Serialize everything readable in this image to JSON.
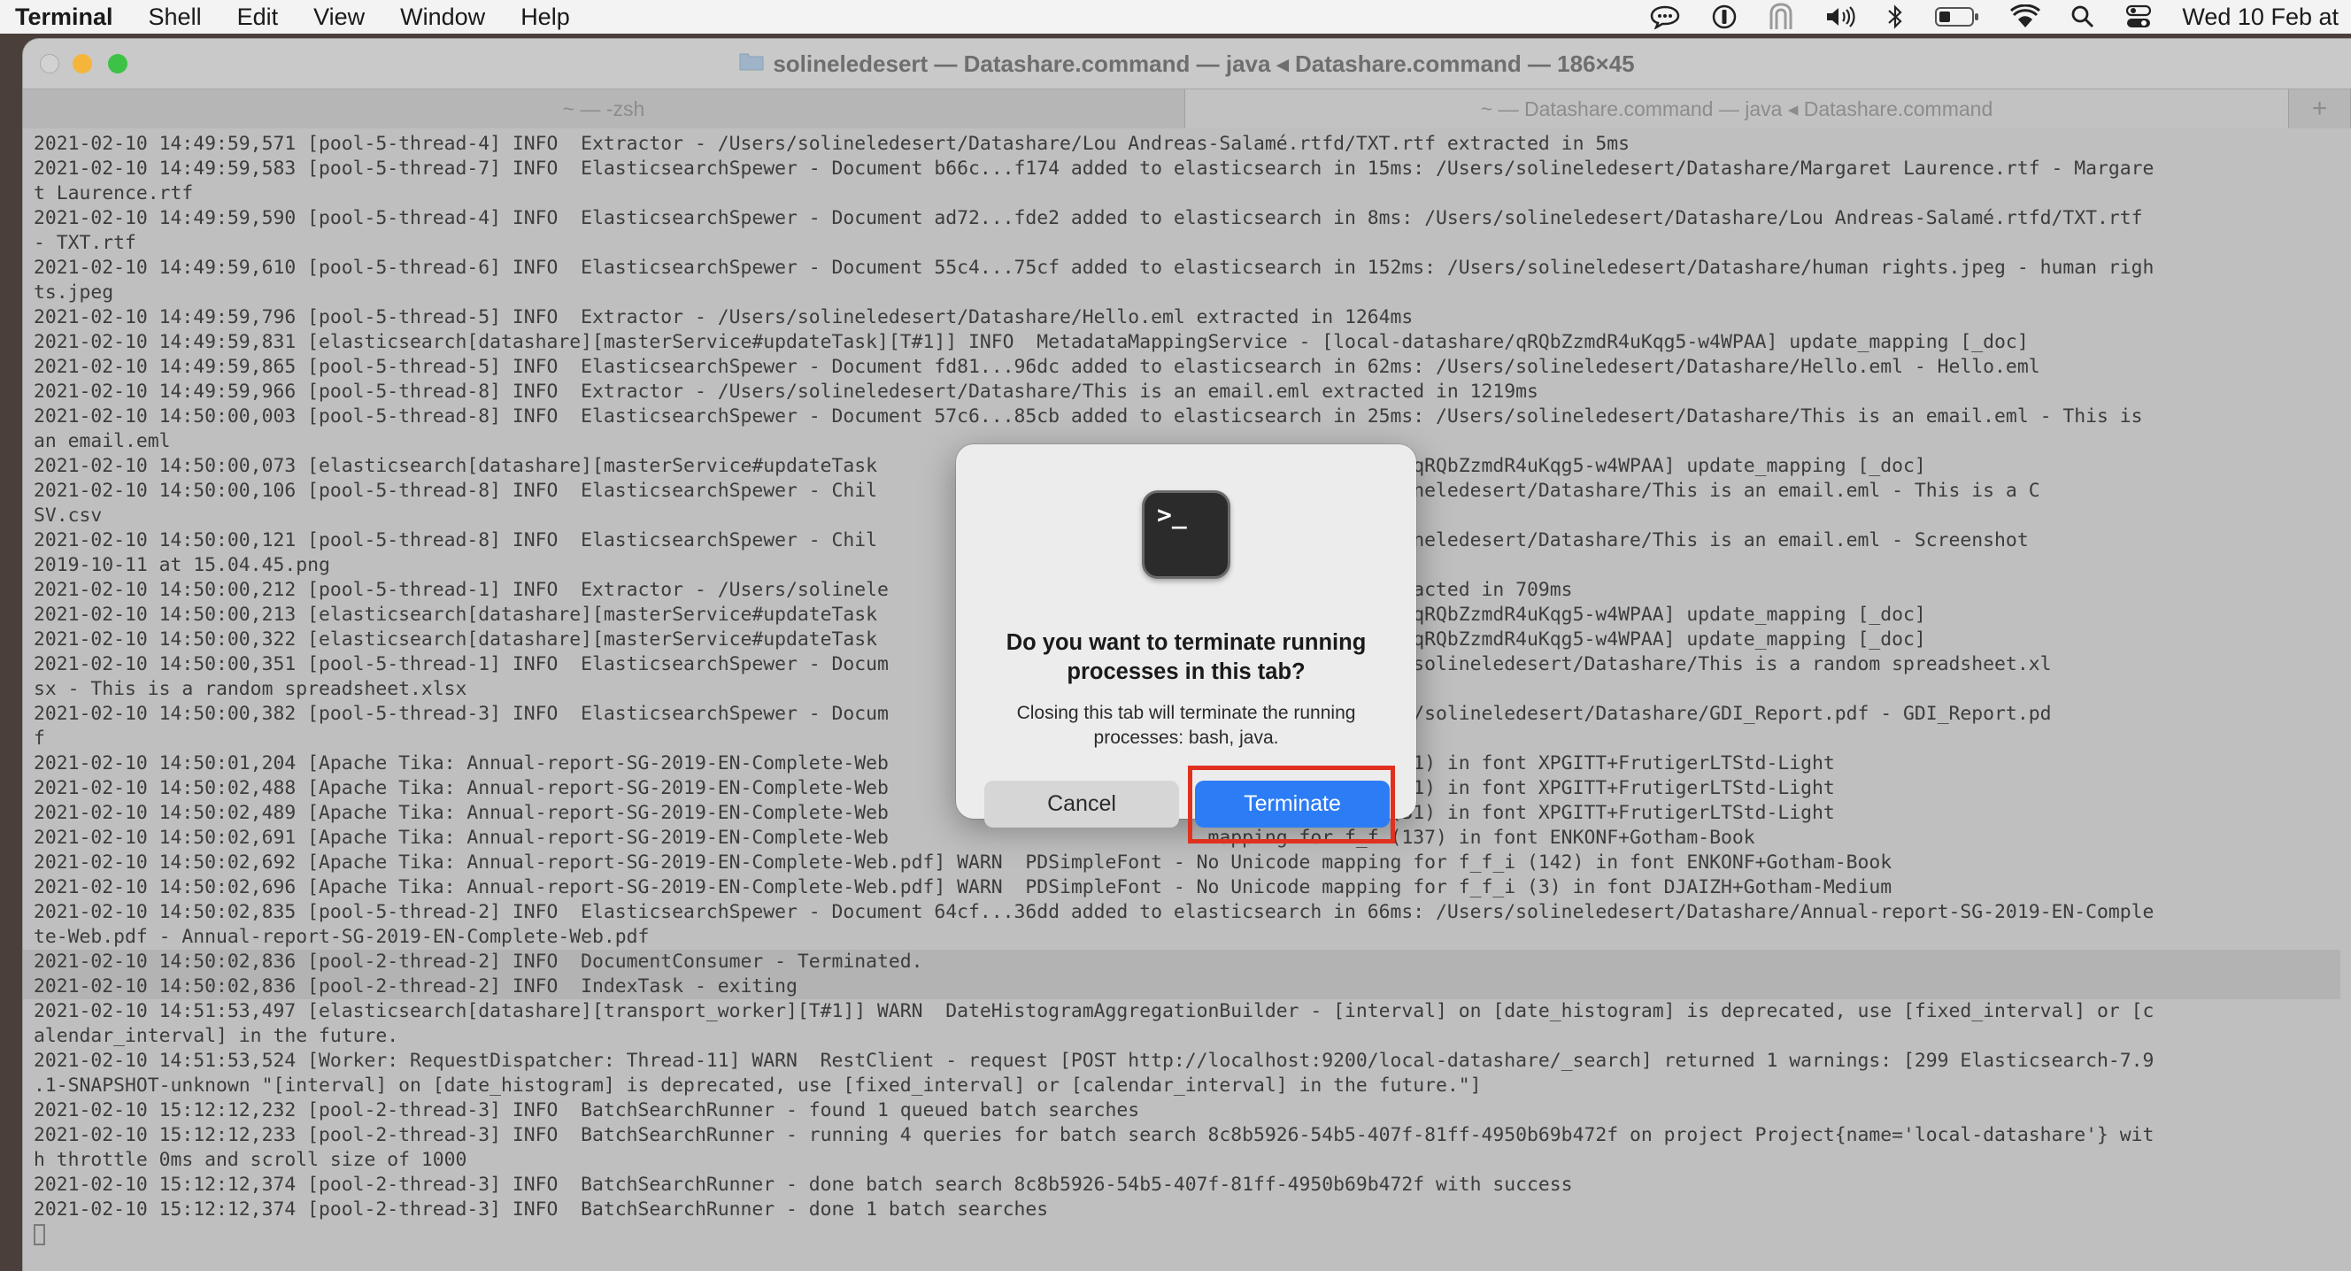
{
  "menubar": {
    "app": "Terminal",
    "items": [
      "Shell",
      "Edit",
      "View",
      "Window",
      "Help"
    ],
    "status_icons": [
      "messages-icon",
      "onepassword-icon",
      "vpn-icon",
      "volume-icon",
      "bluetooth-icon",
      "battery-icon",
      "wifi-icon",
      "search-icon",
      "control-center-icon"
    ],
    "clock": "Wed 10 Feb at"
  },
  "window": {
    "title": "solineledesert — Datashare.command — java ◂ Datashare.command — 186×45",
    "tabs": [
      {
        "label": "~ — -zsh"
      },
      {
        "label": "~ — Datashare.command — java ◂ Datashare.command"
      }
    ],
    "new_tab": "+"
  },
  "terminal": {
    "lines": [
      "2021-02-10 14:49:59,571 [pool-5-thread-4] INFO  Extractor - /Users/solineledesert/Datashare/Lou Andreas-Salamé.rtfd/TXT.rtf extracted in 5ms",
      "2021-02-10 14:49:59,583 [pool-5-thread-7] INFO  ElasticsearchSpewer - Document b66c...f174 added to elasticsearch in 15ms: /Users/solineledesert/Datashare/Margaret Laurence.rtf - Margare",
      "t Laurence.rtf",
      "2021-02-10 14:49:59,590 [pool-5-thread-4] INFO  ElasticsearchSpewer - Document ad72...fde2 added to elasticsearch in 8ms: /Users/solineledesert/Datashare/Lou Andreas-Salamé.rtfd/TXT.rtf",
      "- TXT.rtf",
      "2021-02-10 14:49:59,610 [pool-5-thread-6] INFO  ElasticsearchSpewer - Document 55c4...75cf added to elasticsearch in 152ms: /Users/solineledesert/Datashare/human rights.jpeg - human righ",
      "ts.jpeg",
      "2021-02-10 14:49:59,796 [pool-5-thread-5] INFO  Extractor - /Users/solineledesert/Datashare/Hello.eml extracted in 1264ms",
      "2021-02-10 14:49:59,831 [elasticsearch[datashare][masterService#updateTask][T#1]] INFO  MetadataMappingService - [local-datashare/qRQbZzmdR4uKqg5-w4WPAA] update_mapping [_doc]",
      "2021-02-10 14:49:59,865 [pool-5-thread-5] INFO  ElasticsearchSpewer - Document fd81...96dc added to elasticsearch in 62ms: /Users/solineledesert/Datashare/Hello.eml - Hello.eml",
      "2021-02-10 14:49:59,966 [pool-5-thread-8] INFO  Extractor - /Users/solineledesert/Datashare/This is an email.eml extracted in 1219ms",
      "2021-02-10 14:50:00,003 [pool-5-thread-8] INFO  ElasticsearchSpewer - Document 57c6...85cb added to elasticsearch in 25ms: /Users/solineledesert/Datashare/This is an email.eml - This is",
      "an email.eml",
      "2021-02-10 14:50:00,073 [elasticsearch[datashare][masterService#updateTask                            - [local-datashare/qRQbZzmdR4uKqg5-w4WPAA] update_mapping [_doc]",
      "2021-02-10 14:50:00,106 [pool-5-thread-8] INFO  ElasticsearchSpewer - Chil                            n 78ms: /Users/solineledesert/Datashare/This is an email.eml - This is a C",
      "SV.csv",
      "2021-02-10 14:50:00,121 [pool-5-thread-8] INFO  ElasticsearchSpewer - Chil                            n 12ms: /Users/solineledesert/Datashare/This is an email.eml - Screenshot",
      "2019-10-11 at 15.04.45.png",
      "2021-02-10 14:50:00,212 [pool-5-thread-1] INFO  Extractor - /Users/solinele                           readsheet.xlsx extracted in 709ms",
      "2021-02-10 14:50:00,213 [elasticsearch[datashare][masterService#updateTask                            - [local-datashare/qRQbZzmdR4uKqg5-w4WPAA] update_mapping [_doc]",
      "2021-02-10 14:50:00,322 [elasticsearch[datashare][masterService#updateTask                            - [local-datashare/qRQbZzmdR4uKqg5-w4WPAA] update_mapping [_doc]",
      "2021-02-10 14:50:00,351 [pool-5-thread-1] INFO  ElasticsearchSpewer - Docum                           ch in 49ms: /Users/solineledesert/Datashare/This is a random spreadsheet.xl",
      "sx - This is a random spreadsheet.xlsx",
      "2021-02-10 14:50:00,382 [pool-5-thread-3] INFO  ElasticsearchSpewer - Docum                           ch in 203ms: /Users/solineledesert/Datashare/GDI_Report.pdf - GDI_Report.pd",
      "f",
      "2021-02-10 14:50:01,204 [Apache Tika: Annual-report-SG-2019-EN-Complete-Web                            mapping for f_i (31) in font XPGITT+FrutigerLTStd-Light",
      "2021-02-10 14:50:02,488 [Apache Tika: Annual-report-SG-2019-EN-Complete-Web                            mapping for f_i (31) in font XPGITT+FrutigerLTStd-Light",
      "2021-02-10 14:50:02,489 [Apache Tika: Annual-report-SG-2019-EN-Complete-Web                            mapping for f_i (31) in font XPGITT+FrutigerLTStd-Light",
      "2021-02-10 14:50:02,691 [Apache Tika: Annual-report-SG-2019-EN-Complete-Web                            mapping for f_f (137) in font ENKONF+Gotham-Book",
      "2021-02-10 14:50:02,692 [Apache Tika: Annual-report-SG-2019-EN-Complete-Web.pdf] WARN  PDSimpleFont - No Unicode mapping for f_f_i (142) in font ENKONF+Gotham-Book",
      "2021-02-10 14:50:02,696 [Apache Tika: Annual-report-SG-2019-EN-Complete-Web.pdf] WARN  PDSimpleFont - No Unicode mapping for f_f_i (3) in font DJAIZH+Gotham-Medium",
      "2021-02-10 14:50:02,835 [pool-5-thread-2] INFO  ElasticsearchSpewer - Document 64cf...36dd added to elasticsearch in 66ms: /Users/solineledesert/Datashare/Annual-report-SG-2019-EN-Comple",
      "te-Web.pdf - Annual-report-SG-2019-EN-Complete-Web.pdf",
      "2021-02-10 14:50:02,836 [pool-2-thread-2] INFO  DocumentConsumer - Terminated.",
      "2021-02-10 14:50:02,836 [pool-2-thread-2] INFO  IndexTask - exiting",
      "2021-02-10 14:51:53,497 [elasticsearch[datashare][transport_worker][T#1]] WARN  DateHistogramAggregationBuilder - [interval] on [date_histogram] is deprecated, use [fixed_interval] or [c",
      "alendar_interval] in the future.",
      "2021-02-10 14:51:53,524 [Worker: RequestDispatcher: Thread-11] WARN  RestClient - request [POST http://localhost:9200/local-datashare/_search] returned 1 warnings: [299 Elasticsearch-7.9",
      ".1-SNAPSHOT-unknown \"[interval] on [date_histogram] is deprecated, use [fixed_interval] or [calendar_interval] in the future.\"]",
      "2021-02-10 15:12:12,232 [pool-2-thread-3] INFO  BatchSearchRunner - found 1 queued batch searches",
      "2021-02-10 15:12:12,233 [pool-2-thread-3] INFO  BatchSearchRunner - running 4 queries for batch search 8c8b5926-54b5-407f-81ff-4950b69b472f on project Project{name='local-datashare'} wit",
      "h throttle 0ms and scroll size of 1000",
      "2021-02-10 15:12:12,374 [pool-2-thread-3] INFO  BatchSearchRunner - done batch search 8c8b5926-54b5-407f-81ff-4950b69b472f with success",
      "2021-02-10 15:12:12,374 [pool-2-thread-3] INFO  BatchSearchRunner - done 1 batch searches"
    ],
    "highlighted_lines": [
      33
    ]
  },
  "dialog": {
    "icon": "terminal-app-icon",
    "icon_glyph": ">_",
    "title": "Do you want to terminate running processes in this tab?",
    "message": "Closing this tab will terminate the running processes: bash, java.",
    "cancel_label": "Cancel",
    "terminate_label": "Terminate",
    "annotation_color": "#e0311f"
  }
}
